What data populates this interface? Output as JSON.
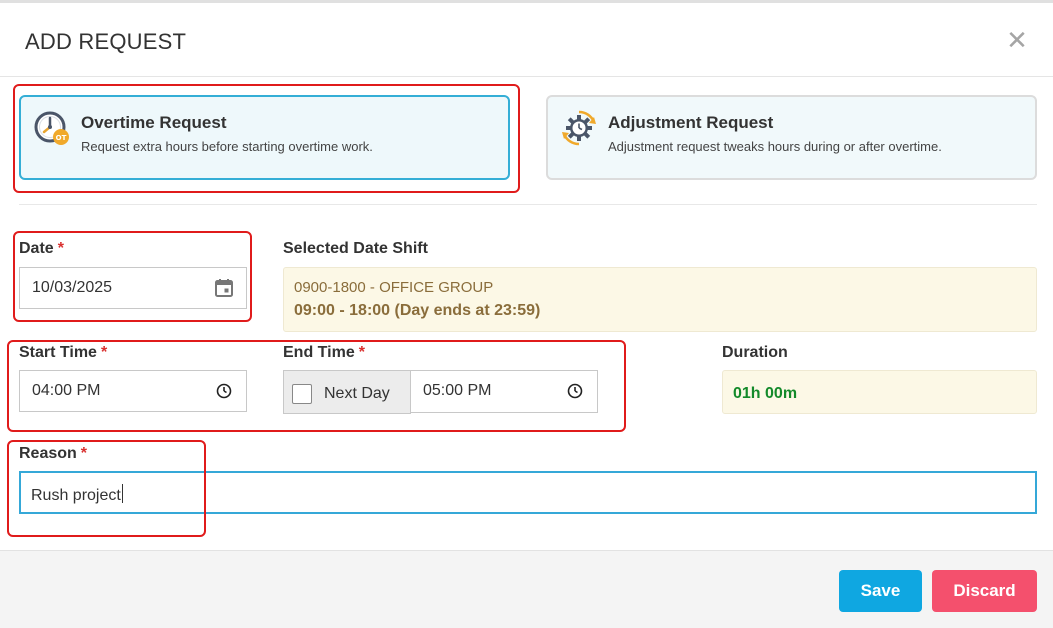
{
  "modal": {
    "title": "ADD REQUEST",
    "close_symbol": "✕"
  },
  "request_types": {
    "overtime": {
      "title": "Overtime Request",
      "description": "Request extra hours before starting overtime work.",
      "icon": "overtime-clock-icon",
      "selected": true
    },
    "adjustment": {
      "title": "Adjustment Request",
      "description": "Adjustment request tweaks hours during or after overtime.",
      "icon": "adjustment-gear-icon",
      "selected": false
    }
  },
  "form": {
    "required_mark": "*",
    "date": {
      "label": "Date",
      "value": "10/03/2025"
    },
    "selected_shift": {
      "label": "Selected Date Shift",
      "shift_name": "0900-1800 - OFFICE GROUP",
      "shift_hours": "09:00 - 18:00 (Day ends at 23:59)"
    },
    "start_time": {
      "label": "Start Time",
      "value": "04:00 PM"
    },
    "end_time": {
      "label": "End Time",
      "next_day_label": "Next Day",
      "next_day_checked": false,
      "value": "05:00 PM"
    },
    "duration": {
      "label": "Duration",
      "value": "01h 00m"
    },
    "reason": {
      "label": "Reason",
      "value": "Rush project"
    }
  },
  "footer": {
    "save_label": "Save",
    "discard_label": "Discard"
  },
  "colors": {
    "accent_blue": "#0fa7e1",
    "discard_pink": "#f4506d",
    "required_red": "#d9302f",
    "duration_green": "#138a2a",
    "annotation_red": "#e01b1b"
  }
}
